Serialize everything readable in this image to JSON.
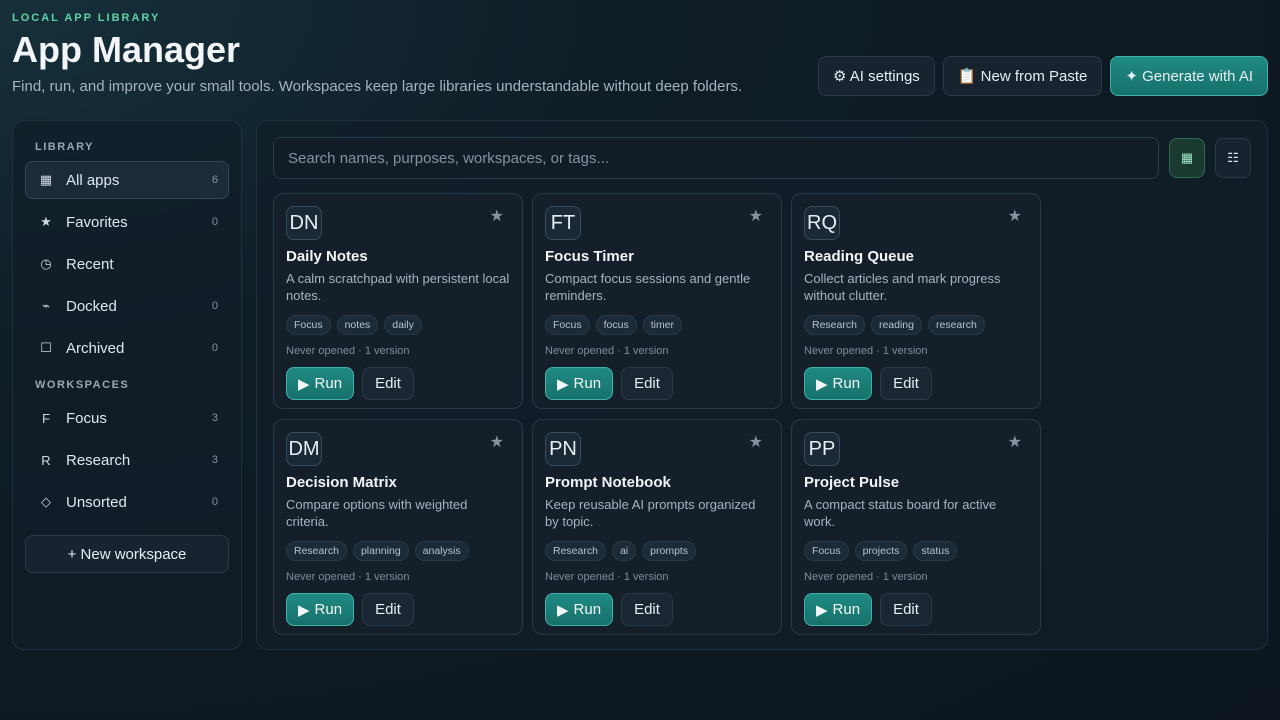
{
  "header": {
    "eyebrow": "LOCAL APP LIBRARY",
    "title": "App Manager",
    "subtitle": "Find, run, and improve your small tools. Workspaces keep large libraries understandable without deep folders."
  },
  "actions": {
    "ai_settings": "⚙ AI settings",
    "new_from_paste": "📋 New from Paste",
    "generate": "✦ Generate with AI"
  },
  "sidebar": {
    "library_label": "LIBRARY",
    "library_items": [
      {
        "icon": "▦",
        "label": "All apps",
        "count": "6"
      },
      {
        "icon": "★",
        "label": "Favorites",
        "count": "0"
      },
      {
        "icon": "◷",
        "label": "Recent",
        "count": ""
      },
      {
        "icon": "⌁",
        "label": "Docked",
        "count": "0"
      },
      {
        "icon": "☐",
        "label": "Archived",
        "count": "0"
      }
    ],
    "workspaces_label": "WORKSPACES",
    "workspace_items": [
      {
        "icon": "F",
        "label": "Focus",
        "count": "3"
      },
      {
        "icon": "R",
        "label": "Research",
        "count": "3"
      },
      {
        "icon": "◇",
        "label": "Unsorted",
        "count": "0"
      }
    ],
    "new_workspace": "+ New workspace"
  },
  "search": {
    "placeholder": "Search names, purposes, workspaces, or tags..."
  },
  "view": {
    "grid_icon": "▦",
    "list_icon": "☷"
  },
  "card_labels": {
    "run": "Run",
    "edit": "Edit",
    "star": "★",
    "play": "▶"
  },
  "apps": [
    {
      "initials": "DN",
      "name": "Daily Notes",
      "desc": "A calm scratchpad with persistent local notes.",
      "tags": [
        "Focus",
        "notes",
        "daily"
      ],
      "meta": "Never opened · 1 version"
    },
    {
      "initials": "FT",
      "name": "Focus Timer",
      "desc": "Compact focus sessions and gentle reminders.",
      "tags": [
        "Focus",
        "focus",
        "timer"
      ],
      "meta": "Never opened · 1 version"
    },
    {
      "initials": "RQ",
      "name": "Reading Queue",
      "desc": "Collect articles and mark progress without clutter.",
      "tags": [
        "Research",
        "reading",
        "research"
      ],
      "meta": "Never opened · 1 version"
    },
    {
      "initials": "DM",
      "name": "Decision Matrix",
      "desc": "Compare options with weighted criteria.",
      "tags": [
        "Research",
        "planning",
        "analysis"
      ],
      "meta": "Never opened · 1 version"
    },
    {
      "initials": "PN",
      "name": "Prompt Notebook",
      "desc": "Keep reusable AI prompts organized by topic.",
      "tags": [
        "Research",
        "ai",
        "prompts"
      ],
      "meta": "Never opened · 1 version"
    },
    {
      "initials": "PP",
      "name": "Project Pulse",
      "desc": "A compact status board for active work.",
      "tags": [
        "Focus",
        "projects",
        "status"
      ],
      "meta": "Never opened · 1 version"
    }
  ]
}
